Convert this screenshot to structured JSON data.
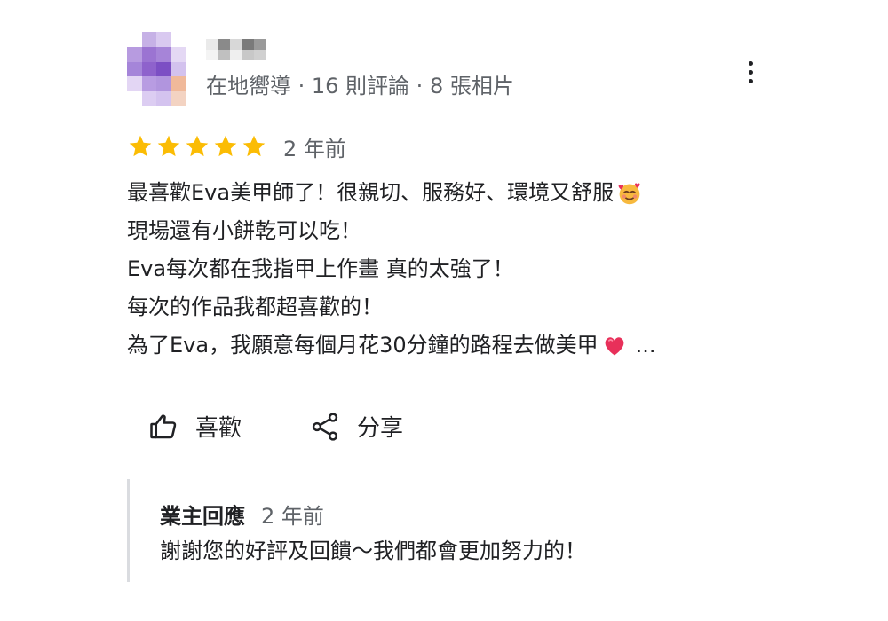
{
  "reviewer": {
    "meta": "在地嚮導 · 16 則評論 · 8 張相片"
  },
  "rating": {
    "stars": 5,
    "max_stars": 5,
    "time": "2 年前",
    "star_color": "#fbbc04"
  },
  "review": {
    "lines": [
      "最喜歡Eva美甲師了！很親切、服務好、環境又舒服",
      "現場還有小餅乾可以吃！",
      "Eva每次都在我指甲上作畫 真的太強了！",
      "每次的作品我都超喜歡的！",
      "為了Eva，我願意每個月花30分鐘的路程去做美甲"
    ],
    "ellipsis": "...",
    "emoji_line1": "smiling-face-with-hearts",
    "emoji_line5": "heart"
  },
  "actions": {
    "like_label": "喜歡",
    "share_label": "分享"
  },
  "owner_reply": {
    "title": "業主回應",
    "time": "2 年前",
    "text": "謝謝您的好評及回饋～我們都會更加努力的！"
  },
  "colors": {
    "meta_text": "#5f6368",
    "reply_border": "#dadce0",
    "heart": "#e8305a"
  }
}
